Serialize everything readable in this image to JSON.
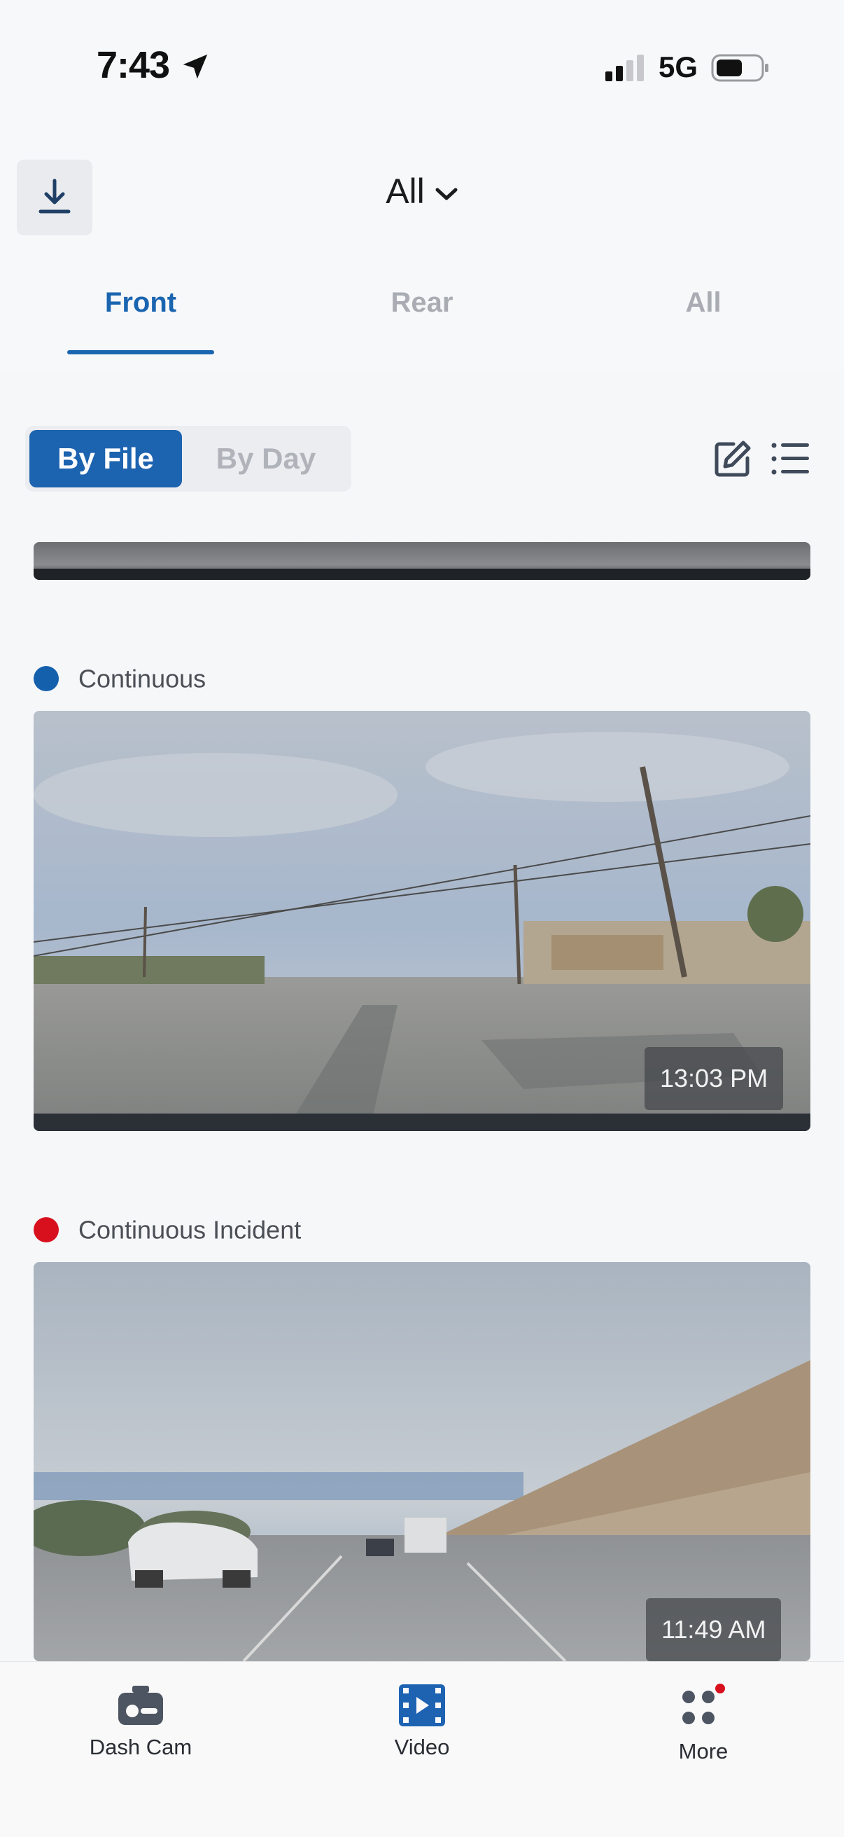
{
  "status_bar": {
    "time": "7:43",
    "network": "5G"
  },
  "header": {
    "filter_label": "All"
  },
  "tabs": [
    {
      "label": "Front",
      "active": true
    },
    {
      "label": "Rear",
      "active": false
    },
    {
      "label": "All",
      "active": false
    }
  ],
  "view_toggle": {
    "by_file": "By File",
    "by_day": "By Day",
    "selected": "By File"
  },
  "clips": [
    {
      "type": "Continuous",
      "dot_color": "#1560ad",
      "time": "13:03 PM"
    },
    {
      "type": "Continuous Incident",
      "dot_color": "#d8101e",
      "time": "11:49 AM"
    }
  ],
  "tabbar": {
    "items": [
      {
        "label": "Dash Cam",
        "icon": "dashcam-icon"
      },
      {
        "label": "Video",
        "icon": "video-icon",
        "active": true
      },
      {
        "label": "More",
        "icon": "more-icon",
        "badge": true
      }
    ]
  },
  "colors": {
    "accent": "#1a65b0",
    "incident": "#d8101e",
    "continuous": "#1560ad"
  }
}
